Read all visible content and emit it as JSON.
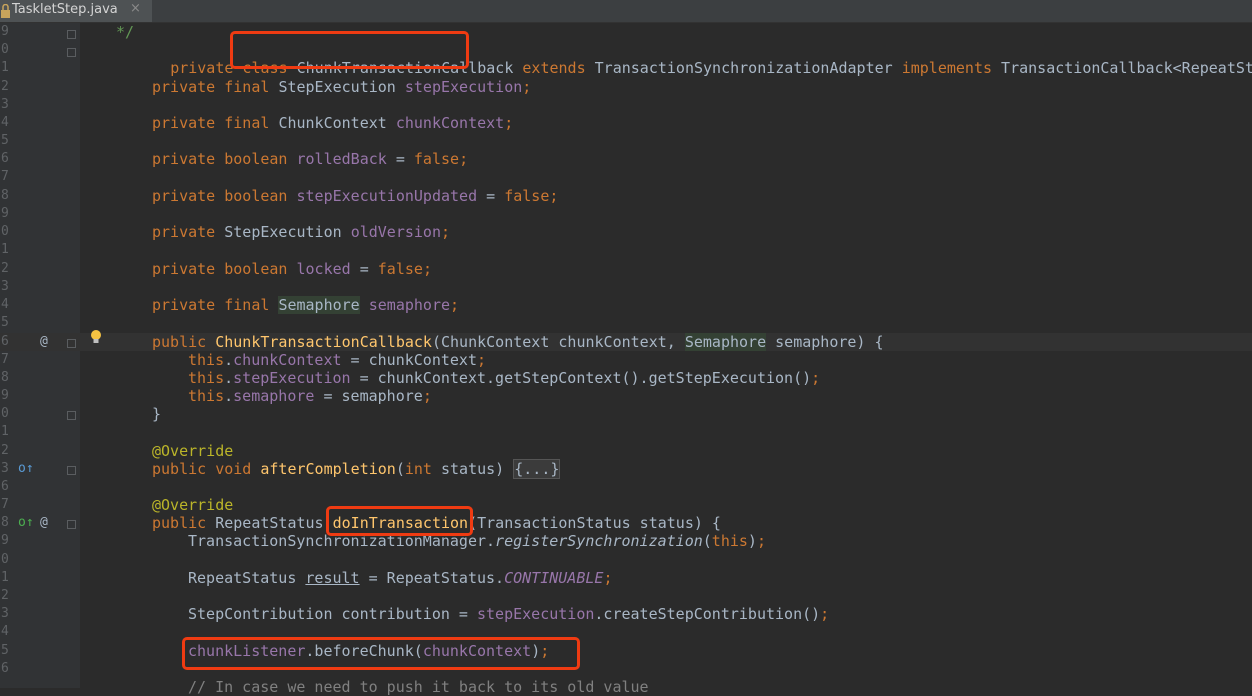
{
  "tab": {
    "file_name": "TaskletStep.java",
    "close_glyph": "×"
  },
  "gutter": {
    "line_numbers": [
      "9",
      "0",
      "1",
      "2",
      "3",
      "4",
      "5",
      "6",
      "7",
      "8",
      "9",
      "0",
      "1",
      "2",
      "3",
      "4",
      "5",
      "6",
      "7",
      "8",
      "9",
      "0",
      "1",
      "2",
      "3",
      "6",
      "7",
      "8",
      "9",
      "0",
      "1",
      "2",
      "3",
      "4",
      "5",
      "6"
    ],
    "override_at": "@",
    "implements_marker": "o↑",
    "override_marker": "o↑"
  },
  "code": {
    "l0": "*/",
    "l1_kw": "private class ",
    "l1_name": "ChunkTransactionCallback",
    "l1_ext": " extends ",
    "l1_base": "TransactionSynchronizationAdapter",
    "l1_impl": " implements ",
    "l1_iface": "TransactionCallback<RepeatStatus>",
    "l3_kw": "private final ",
    "l3_type": "StepExecution ",
    "l3_f": "stepExecution",
    "l3_end": ";",
    "l5_kw": "private final ",
    "l5_type": "ChunkContext ",
    "l5_f": "chunkContext",
    "l5_end": ";",
    "l7_kw": "private boolean ",
    "l7_f": "rolledBack",
    "l7_eq": " = ",
    "l7_v": "false",
    "l7_end": ";",
    "l9_kw": "private boolean ",
    "l9_f": "stepExecutionUpdated",
    "l9_eq": " = ",
    "l9_v": "false",
    "l9_end": ";",
    "l11_kw": "private ",
    "l11_type": "StepExecution ",
    "l11_f": "oldVersion",
    "l11_end": ";",
    "l13_kw": "private boolean ",
    "l13_f": "locked",
    "l13_eq": " = ",
    "l13_v": "false",
    "l13_end": ";",
    "l15_kw": "private final ",
    "l15_type": "Semaphore",
    "l15_sp": " ",
    "l15_f": "semaphore",
    "l15_end": ";",
    "l17_kw": "public ",
    "l17_m": "ChunkTransactionCallback",
    "l17_a": "(ChunkContext chunkContext, ",
    "l17_b": "Semaphore",
    "l17_c": " semaphore) {",
    "l18_this": "this",
    "l18_dot": ".",
    "l18_f": "chunkContext",
    "l18_rest": " = chunkContext",
    "l18_end": ";",
    "l19_this": "this",
    "l19_dot": ".",
    "l19_f": "stepExecution",
    "l19_rest": " = chunkContext.getStepContext().getStepExecution()",
    "l19_end": ";",
    "l20_this": "this",
    "l20_dot": ".",
    "l20_f": "semaphore",
    "l20_rest": " = semaphore",
    "l20_end": ";",
    "l21": "}",
    "l23": "@Override",
    "l24_kw": "public void ",
    "l24_m": "afterCompletion",
    "l24_a": "(",
    "l24_int": "int",
    "l24_b": " status) ",
    "l24_fold": "{...}",
    "l26": "@Override",
    "l27_kw": "public ",
    "l27_type": "RepeatStatus ",
    "l27_m": "doInTransaction",
    "l27_rest": "(TransactionStatus status) {",
    "l28_a": "TransactionSynchronizationManager.",
    "l28_m": "registerSynchronization",
    "l28_b": "(",
    "l28_this": "this",
    "l28_c": ")",
    "l28_end": ";",
    "l30_a": "RepeatStatus ",
    "l30_v": "result",
    "l30_b": " = RepeatStatus.",
    "l30_c": "CONTINUABLE",
    "l30_end": ";",
    "l32_a": "StepContribution contribution = ",
    "l32_f": "stepExecution",
    "l32_b": ".createStepContribution()",
    "l32_end": ";",
    "l34_f": "chunkListener",
    "l34_a": ".beforeChunk(",
    "l34_b": "chunkContext",
    "l34_c": ")",
    "l34_end": ";",
    "l36": "// In case we need to push it back to its old value"
  }
}
